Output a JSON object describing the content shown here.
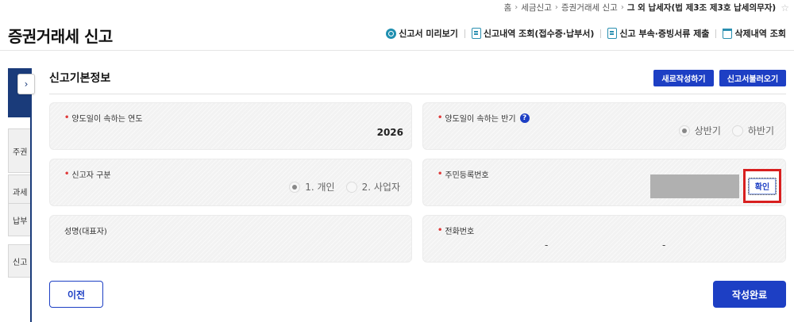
{
  "breadcrumb": {
    "items": [
      "홈",
      "세금신고",
      "증권거래세 신고"
    ],
    "current": "그 외 납세자(법 제3조 제3호 납세의무자)"
  },
  "page": {
    "title": "증권거래세 신고"
  },
  "actions": {
    "preview": "신고서 미리보기",
    "history": "신고내역 조회(접수증·납부서)",
    "attach": "신고 부속·증빙서류 제출",
    "deleted": "삭제내역 조회"
  },
  "sidenav": {
    "items": [
      "주권",
      "과세",
      "납부",
      "신고"
    ]
  },
  "section": {
    "title": "신고기본정보",
    "new_button": "새로작성하기",
    "load_button": "신고서불러오기"
  },
  "form": {
    "year": {
      "label": "양도일이 속하는 연도",
      "value": "2026"
    },
    "half": {
      "label": "양도일이 속하는 반기",
      "help": "?",
      "options": [
        "상반기",
        "하반기"
      ],
      "selected": "상반기"
    },
    "filer_type": {
      "label": "신고자 구분",
      "options": [
        "1. 개인",
        "2. 사업자"
      ],
      "selected": "1. 개인"
    },
    "resident_id": {
      "label": "주민등록번호",
      "confirm_button": "확인"
    },
    "name": {
      "label": "성명(대표자)"
    },
    "phone": {
      "label": "전화번호",
      "sep1": "-",
      "sep2": "-"
    }
  },
  "footer": {
    "prev_button": "이전",
    "done_button": "작성완료"
  },
  "colors": {
    "primary": "#1d3fc4",
    "nav": "#1a3b7a",
    "highlight": "#d81f1f",
    "required": "#e03a3a"
  }
}
